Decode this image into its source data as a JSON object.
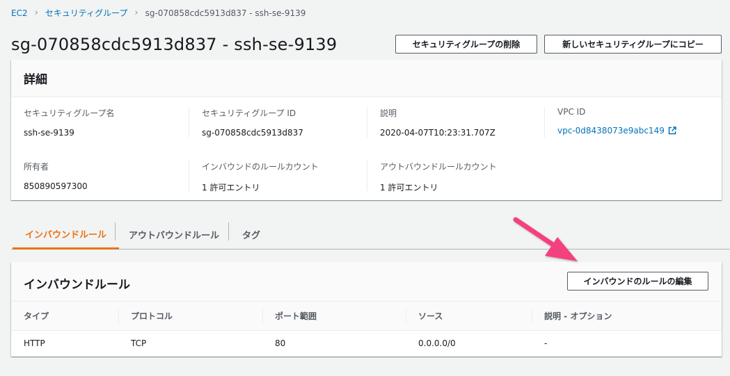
{
  "breadcrumb": {
    "items": [
      "EC2",
      "セキュリティグループ"
    ],
    "current": "sg-070858cdc5913d837 - ssh-se-9139"
  },
  "page_title": "sg-070858cdc5913d837 - ssh-se-9139",
  "header_buttons": {
    "delete": "セキュリティグループの削除",
    "copy": "新しいセキュリティグループにコピー"
  },
  "details": {
    "title": "詳細",
    "fields": [
      {
        "label": "セキュリティグループ名",
        "value": "ssh-se-9139"
      },
      {
        "label": "セキュリティグループ ID",
        "value": "sg-070858cdc5913d837"
      },
      {
        "label": "説明",
        "value": "2020-04-07T10:23:31.707Z"
      },
      {
        "label": "VPC ID",
        "value": "vpc-0d8438073e9abc149"
      },
      {
        "label": "所有者",
        "value": "850890597300"
      },
      {
        "label": "インバウンドのルールカウント",
        "value": "1 許可エントリ"
      },
      {
        "label": "アウトバウンドルールカウント",
        "value": "1 許可エントリ"
      }
    ]
  },
  "tabs": [
    "インバウンドルール",
    "アウトバウンドルール",
    "タグ"
  ],
  "inbound_rules": {
    "title": "インバウンドルール",
    "edit_button": "インバウンドのルールの編集",
    "columns": [
      "タイプ",
      "プロトコル",
      "ポート範囲",
      "ソース",
      "説明 - オプション"
    ],
    "rows": [
      [
        "HTTP",
        "TCP",
        "80",
        "0.0.0.0/0",
        "-"
      ]
    ]
  },
  "colors": {
    "link": "#0073bb",
    "active_tab": "#ec7211",
    "annotation_arrow": "#f43f7f"
  },
  "icons": [
    "chevron-right-icon",
    "external-link-icon",
    "annotation-arrow"
  ]
}
